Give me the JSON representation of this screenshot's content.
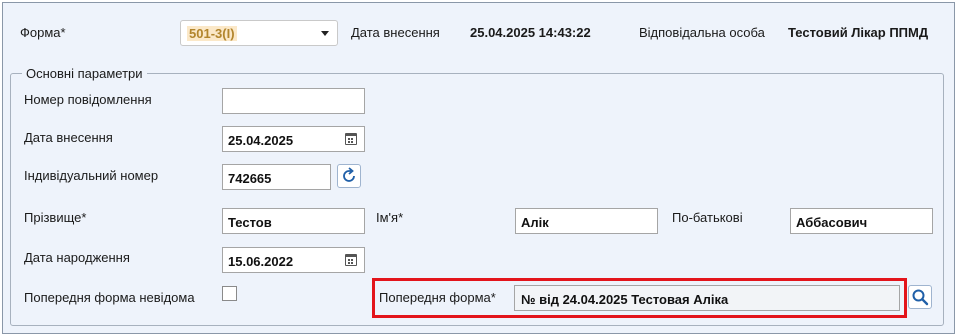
{
  "header": {
    "form_label": "Форма*",
    "form_value": "501-3(І)",
    "entry_date_label": "Дата внесення",
    "entry_date_value": "25.04.2025 14:43:22",
    "responsible_label": "Відповідальна особа",
    "responsible_value": "Тестовий Лікар ППМД"
  },
  "group": {
    "legend": "Основні параметри",
    "report_number_label": "Номер повідомлення",
    "report_number_value": "",
    "entry_date_label": "Дата внесення",
    "entry_date_value": "25.04.2025",
    "individual_number_label": "Індивідуальний номер",
    "individual_number_value": "742665",
    "surname_label": "Прізвище*",
    "surname_value": "Тестов",
    "name_label": "Ім'я*",
    "name_value": "Алік",
    "patronymic_label": "По-батькові",
    "patronymic_value": "Аббасович",
    "birth_date_label": "Дата народження",
    "birth_date_value": "15.06.2022",
    "prev_form_unknown_label": "Попередня форма невідома",
    "prev_form_label": "Попередня форма*",
    "prev_form_value": "№  від 24.04.2025 Тестовая Аліка"
  },
  "colors": {
    "highlight": "#e3141b",
    "accent": "#1f5fa8",
    "panel_bg": "#eef3fb"
  }
}
